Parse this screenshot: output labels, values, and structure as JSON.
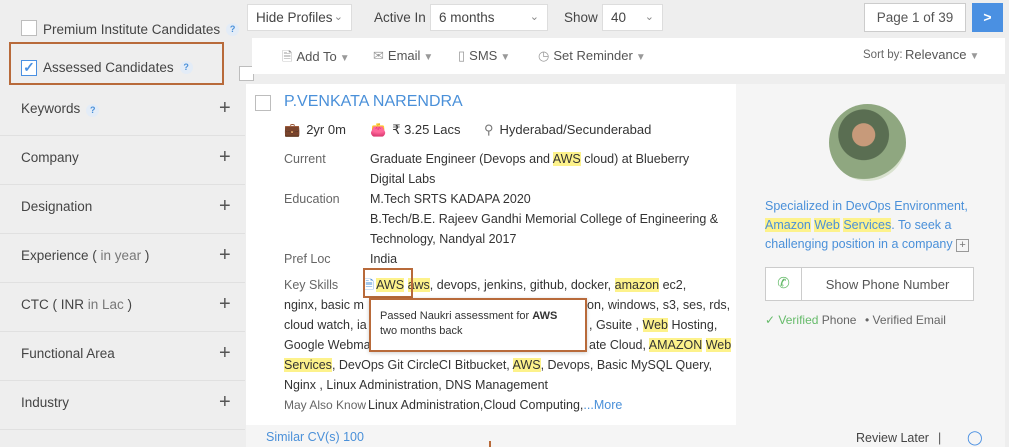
{
  "sidebar": {
    "premium_label": "Premium Institute Candidates",
    "assessed_label": "Assessed Candidates",
    "help": "?",
    "filters": [
      {
        "label": "Keywords",
        "sub": ""
      },
      {
        "label": "Company",
        "sub": ""
      },
      {
        "label": "Designation",
        "sub": ""
      },
      {
        "label": "Experience (",
        "sub": " in year ",
        "end": ")"
      },
      {
        "label": "CTC ( INR ",
        "sub": "in Lac",
        "end": " )"
      },
      {
        "label": "Functional Area",
        "sub": ""
      },
      {
        "label": "Industry",
        "sub": ""
      }
    ],
    "plus": "+"
  },
  "topbar": {
    "hide_profiles": "Hide Profiles",
    "active_in_label": "Active In",
    "active_in_value": "6 months",
    "show_label": "Show",
    "show_value": "40",
    "page_text": "Page 1 of 39",
    "next": ">"
  },
  "actions": {
    "add_to": "Add To",
    "email": "Email",
    "sms": "SMS",
    "set_reminder": "Set Reminder",
    "sort_by_label": "Sort by:",
    "sort_by_value": "Relevance"
  },
  "candidate": {
    "name": "P.VENKATA NARENDRA",
    "experience": "2yr 0m",
    "salary": "₹ 3.25 Lacs",
    "location": "Hyderabad/Secunderabad",
    "current_label": "Current",
    "current_a": "Graduate Engineer (Devops and ",
    "current_hl": "AWS",
    "current_b": " cloud) at Blueberry",
    "current_line2": "Digital Labs",
    "education_label": "Education",
    "education_1": "M.Tech SRTS KADAPA 2020",
    "education_2": "B.Tech/B.E. Rajeev Gandhi Memorial College of Engineering &",
    "education_3": "Technology, Nandyal 2017",
    "pref_loc_label": "Pref Loc",
    "pref_loc": "India",
    "key_skills_label": "Key Skills",
    "skills_line1_hl1": "AWS",
    "skills_line1_hl2": "aws",
    "skills_line1_mid": ", devops, jenkins, github, docker, ",
    "skills_line1_hl3": "amazon",
    "skills_line1_end": " ec2,",
    "skills_line2_a": "nginx, basic m",
    "skills_line2_b": "on, windows, s3, ses, rds,",
    "skills_line3_a": "cloud watch, ia",
    "skills_line3_b": ", Gsuite , ",
    "skills_line3_hl": "Web",
    "skills_line3_c": " Hosting,",
    "skills_line4_a": "Google Webma",
    "skills_line4_b": "ate Cloud, ",
    "skills_line4_hl1": "AMAZON",
    "skills_line4_hl2": "Web",
    "skills_line5_hl": "Services",
    "skills_line5_a": ", DevOps Git CircleCI Bitbucket, ",
    "skills_line5_hl2": "AWS",
    "skills_line5_b": ", Devops, Basic MySQL Query,",
    "skills_line6": "Nginx , Linux Administration, DNS Management",
    "may_also_label": "May Also Know",
    "may_also": "Linux Administration,Cloud Computing,",
    "more": "...More",
    "tooltip_a": "Passed Naukri assessment for ",
    "tooltip_b": "AWS",
    "tooltip_c": "two months back",
    "summary_a": "Specialized in DevOps Environment, ",
    "summary_hl1": "Amazon",
    "summary_hl2": "Web",
    "summary_hl3": "Services",
    "summary_b": ". To seek a challenging position in a company",
    "show_phone": "Show Phone Number",
    "verified_phone_a": "Verified",
    "verified_phone_b": " Phone",
    "verified_email": "Verified Email",
    "similar": "Similar CV(s) 100",
    "review_later": "Review Later",
    "sep": "|"
  },
  "colors": {
    "accent": "#4a90e2",
    "highlight": "#fdf28b",
    "callout": "#b86a3a"
  }
}
